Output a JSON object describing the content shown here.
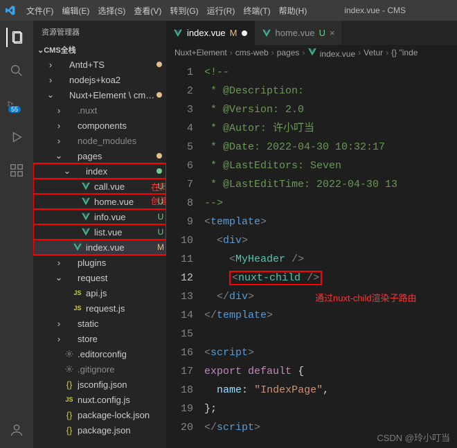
{
  "titlebar": {
    "menu": [
      "文件(F)",
      "编辑(E)",
      "选择(S)",
      "查看(V)",
      "转到(G)",
      "运行(R)",
      "终端(T)",
      "帮助(H)"
    ],
    "title": "index.vue - CMS"
  },
  "activity": {
    "scm_badge": "55"
  },
  "sidebar": {
    "title": "资源管理器",
    "section": "CMS全栈",
    "tree": [
      {
        "depth": 1,
        "twisty": ">",
        "icon": "folder",
        "label": "Antd+TS",
        "dim": false,
        "dot": "M"
      },
      {
        "depth": 1,
        "twisty": ">",
        "icon": "folder",
        "label": "nodejs+koa2",
        "dim": false
      },
      {
        "depth": 1,
        "twisty": "v",
        "icon": "folder",
        "label": "Nuxt+Element \\ cms...",
        "dim": false,
        "dot": "M"
      },
      {
        "depth": 2,
        "twisty": ">",
        "icon": "folder",
        "label": ".nuxt",
        "dim": true
      },
      {
        "depth": 2,
        "twisty": ">",
        "icon": "folder",
        "label": "components",
        "dim": false
      },
      {
        "depth": 2,
        "twisty": ">",
        "icon": "folder",
        "label": "node_modules",
        "dim": true
      },
      {
        "depth": 2,
        "twisty": "v",
        "icon": "folder",
        "label": "pages",
        "dim": false,
        "dot": "M"
      },
      {
        "depth": 3,
        "twisty": "v",
        "icon": "folder",
        "label": "index",
        "dim": false,
        "dot": "U",
        "red": true
      },
      {
        "depth": 4,
        "twisty": "",
        "icon": "vue",
        "label": "call.vue",
        "status": "U",
        "red": true
      },
      {
        "depth": 4,
        "twisty": "",
        "icon": "vue",
        "label": "home.vue",
        "status": "U",
        "red": true
      },
      {
        "depth": 4,
        "twisty": "",
        "icon": "vue",
        "label": "info.vue",
        "status": "U",
        "red": true
      },
      {
        "depth": 4,
        "twisty": "",
        "icon": "vue",
        "label": "list.vue",
        "status": "U",
        "red": true
      },
      {
        "depth": 3,
        "twisty": "",
        "icon": "vue",
        "label": "index.vue",
        "status": "M",
        "red": true,
        "selected": true
      },
      {
        "depth": 2,
        "twisty": ">",
        "icon": "folder",
        "label": "plugins",
        "dim": false
      },
      {
        "depth": 2,
        "twisty": "v",
        "icon": "folder",
        "label": "request",
        "dim": false
      },
      {
        "depth": 3,
        "twisty": "",
        "icon": "js",
        "label": "api.js"
      },
      {
        "depth": 3,
        "twisty": "",
        "icon": "js",
        "label": "request.js"
      },
      {
        "depth": 2,
        "twisty": ">",
        "icon": "folder",
        "label": "static",
        "dim": false
      },
      {
        "depth": 2,
        "twisty": ">",
        "icon": "folder",
        "label": "store",
        "dim": false
      },
      {
        "depth": 2,
        "twisty": "",
        "icon": "gear",
        "label": ".editorconfig",
        "dim": false
      },
      {
        "depth": 2,
        "twisty": "",
        "icon": "gear",
        "label": ".gitignore",
        "dim": true
      },
      {
        "depth": 2,
        "twisty": "",
        "icon": "json",
        "label": "jsconfig.json"
      },
      {
        "depth": 2,
        "twisty": "",
        "icon": "js",
        "label": "nuxt.config.js"
      },
      {
        "depth": 2,
        "twisty": "",
        "icon": "json",
        "label": "package-lock.json"
      },
      {
        "depth": 2,
        "twisty": "",
        "icon": "json",
        "label": "package.json"
      }
    ]
  },
  "tabs": [
    {
      "icon": "vue",
      "label": "index.vue",
      "suffix": "M",
      "suffixClass": "mod",
      "active": true,
      "dirty": true
    },
    {
      "icon": "vue",
      "label": "home.vue",
      "suffix": "U",
      "suffixClass": "unt",
      "active": false
    }
  ],
  "breadcrumbs": [
    "Nuxt+Element",
    "cms-web",
    "pages",
    "index.vue",
    "Vetur",
    "{} \"inde"
  ],
  "code": {
    "lines": [
      {
        "n": 1,
        "html": "<span class='c-comment'>&lt;!--</span>"
      },
      {
        "n": 2,
        "html": "<span class='c-comment'> * @Description: </span>"
      },
      {
        "n": 3,
        "html": "<span class='c-comment'> * @Version: 2.0</span>"
      },
      {
        "n": 4,
        "html": "<span class='c-comment'> * @Autor: 许小叮当</span>"
      },
      {
        "n": 5,
        "html": "<span class='c-comment'> * @Date: 2022-04-30 10:32:17</span>"
      },
      {
        "n": 6,
        "html": "<span class='c-comment'> * @LastEditors: Seven</span>"
      },
      {
        "n": 7,
        "html": "<span class='c-comment'> * @LastEditTime: 2022-04-30 13</span>"
      },
      {
        "n": 8,
        "html": "<span class='c-comment'>--&gt;</span>"
      },
      {
        "n": 9,
        "html": "<span class='c-bracket'>&lt;</span><span class='c-tag'>template</span><span class='c-bracket'>&gt;</span>"
      },
      {
        "n": 10,
        "html": "  <span class='c-bracket'>&lt;</span><span class='c-tag'>div</span><span class='c-bracket'>&gt;</span>"
      },
      {
        "n": 11,
        "html": "    <span class='c-bracket'>&lt;</span><span class='c-component'>MyHeader</span> <span class='c-bracket'>/&gt;</span>"
      },
      {
        "n": 12,
        "current": true,
        "html": "    <span class='nuxt-box'><span class='c-bracket'>&lt;</span><span class='c-component'>nuxt-child</span> <span class='c-bracket'>/&gt;</span></span>"
      },
      {
        "n": 13,
        "html": "  <span class='c-bracket'>&lt;/</span><span class='c-tag'>div</span><span class='c-bracket'>&gt;</span>"
      },
      {
        "n": 14,
        "html": "<span class='c-bracket'>&lt;/</span><span class='c-tag'>template</span><span class='c-bracket'>&gt;</span>"
      },
      {
        "n": 15,
        "html": ""
      },
      {
        "n": 16,
        "html": "<span class='c-bracket'>&lt;</span><span class='c-tag'>script</span><span class='c-bracket'>&gt;</span>"
      },
      {
        "n": 17,
        "html": "<span class='c-keyword'>export</span> <span class='c-keyword'>default</span> <span class='c-punct'>{</span>"
      },
      {
        "n": 18,
        "html": "  <span class='c-attr'>name</span><span class='c-punct'>:</span> <span class='c-string'>\"IndexPage\"</span><span class='c-punct'>,</span>"
      },
      {
        "n": 19,
        "html": "<span class='c-punct'>};</span>"
      },
      {
        "n": 20,
        "html": "<span class='c-bracket'>&lt;/</span><span class='c-tag'>script</span><span class='c-bracket'>&gt;</span>"
      }
    ]
  },
  "annotations": {
    "tree1": "在同名index的vue文件下",
    "tree2": "创建同名文件夹",
    "code1": "通过nuxt-child渲染子路由"
  },
  "watermark": "CSDN @玲小叮当"
}
